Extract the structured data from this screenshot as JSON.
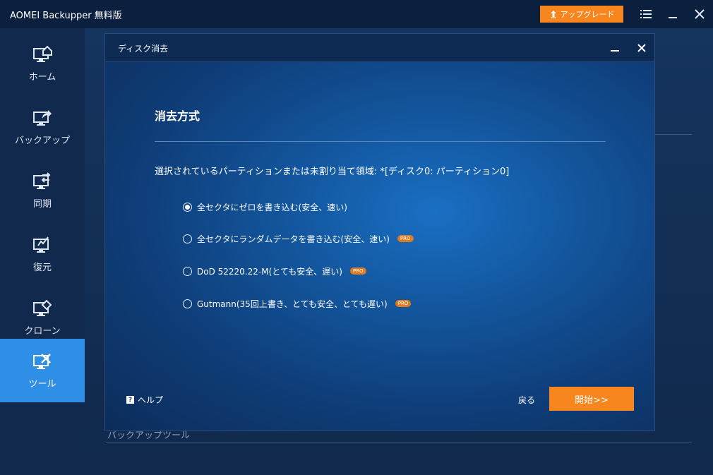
{
  "app": {
    "title": "AOMEI Backupper 無料版",
    "upgrade_label": "アップグレード"
  },
  "sidebar": {
    "items": [
      {
        "label": "ホーム",
        "icon": "home-monitor-icon"
      },
      {
        "label": "バックアップ",
        "icon": "backup-monitor-icon"
      },
      {
        "label": "同期",
        "icon": "sync-monitor-icon"
      },
      {
        "label": "復元",
        "icon": "restore-monitor-icon"
      },
      {
        "label": "クローン",
        "icon": "clone-monitor-icon"
      },
      {
        "label": "ツール",
        "icon": "tools-monitor-icon",
        "active": true
      }
    ]
  },
  "background": {
    "section_label": "バックアップツール"
  },
  "dialog": {
    "title": "ディスク消去",
    "section_title": "消去方式",
    "description": "選択されているパーティションまたは未割り当て領域: *[ディスク0: パーティション0]",
    "options": [
      {
        "label": "全セクタにゼロを書き込む(安全、速い)",
        "checked": true,
        "pro": false
      },
      {
        "label": "全セクタにランダムデータを書き込む(安全、速い)",
        "checked": false,
        "pro": true
      },
      {
        "label": "DoD 52220.22-M(とても安全、遅い)",
        "checked": false,
        "pro": true
      },
      {
        "label": "Gutmann(35回上書き、とても安全、とても遅い)",
        "checked": false,
        "pro": true
      }
    ],
    "pro_badge": "PRO",
    "help_label": "ヘルプ",
    "back_label": "戻る",
    "start_label": "開始>>"
  },
  "colors": {
    "accent_orange": "#f7861e",
    "active_blue": "#2f8ee6",
    "pro_badge": "#e07b22"
  }
}
